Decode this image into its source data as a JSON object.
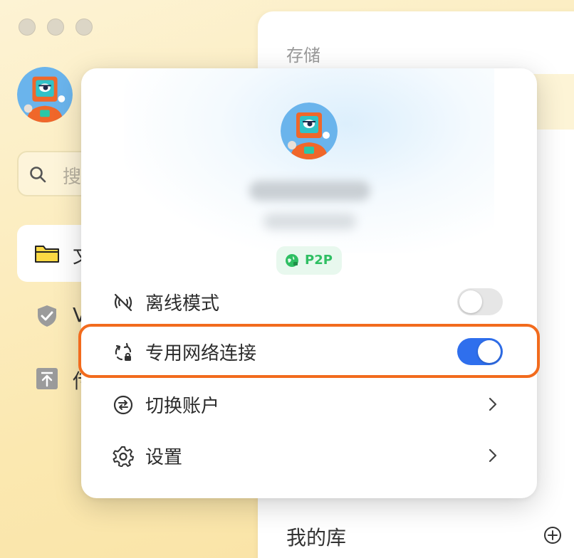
{
  "window": {
    "traffic_lights": [
      "close",
      "minimize",
      "zoom"
    ]
  },
  "sidebar": {
    "search_placeholder": "搜",
    "items": [
      {
        "label": "文",
        "icon": "folder-icon",
        "active": true
      },
      {
        "label": "V",
        "icon": "shield-icon",
        "active": false
      },
      {
        "label": "传",
        "icon": "upload-icon",
        "active": false
      }
    ]
  },
  "main": {
    "title": "存储",
    "library_title": "我的库",
    "add_icon": "plus-circle-icon"
  },
  "popup": {
    "badge": "P2P",
    "menu": [
      {
        "label": "离线模式",
        "icon": "offline-signal-icon",
        "control": "toggle",
        "checked": false
      },
      {
        "label": "专用网络连接",
        "icon": "private-network-icon",
        "control": "toggle",
        "checked": true
      },
      {
        "label": "切换账户",
        "icon": "switch-account-icon",
        "control": "chevron"
      },
      {
        "label": "设置",
        "icon": "gear-icon",
        "control": "chevron"
      }
    ]
  },
  "colors": {
    "accent": "#2f6fed",
    "highlight": "#f26b1d",
    "p2p_green": "#2fbf63"
  }
}
